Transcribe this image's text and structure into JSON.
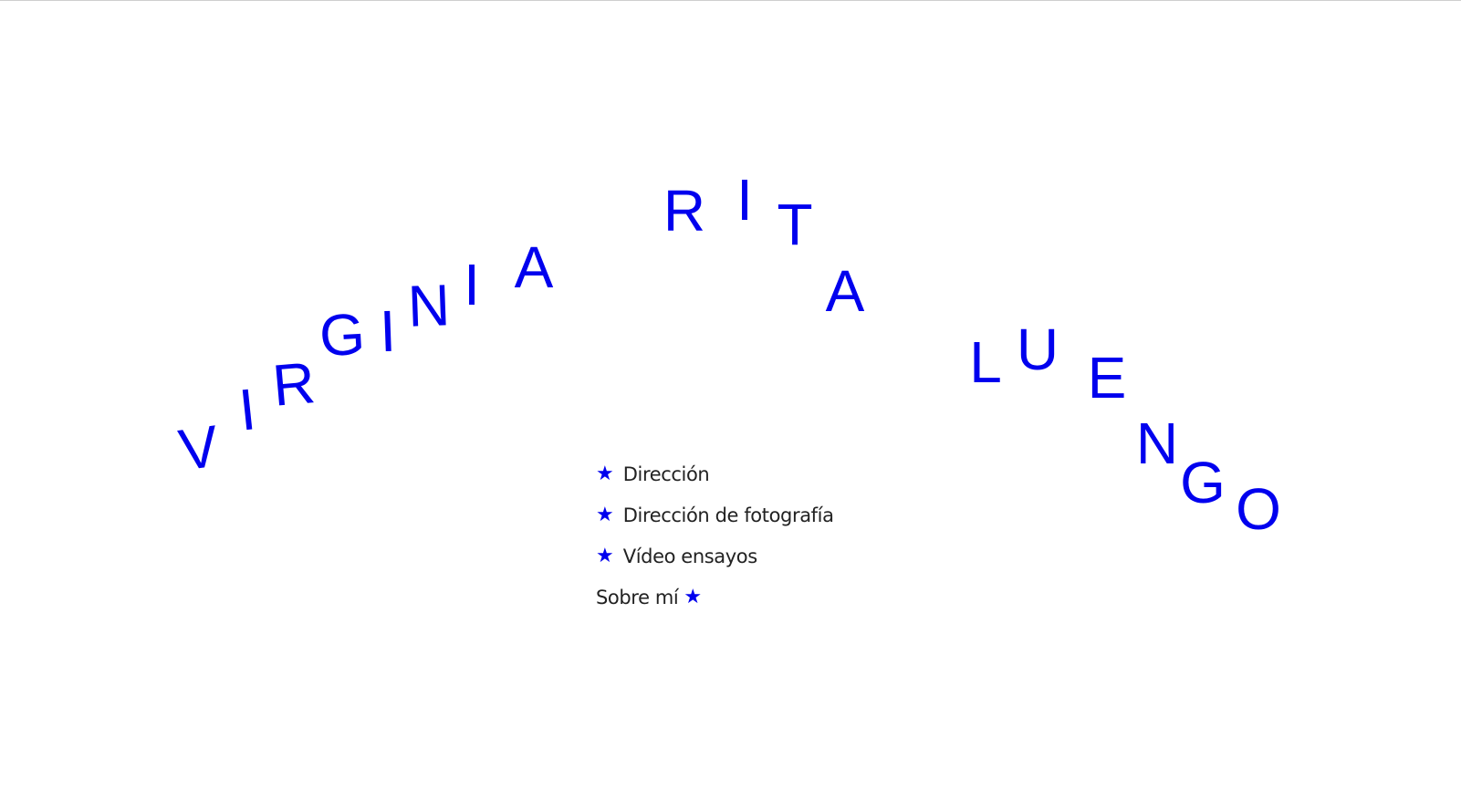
{
  "brand": {
    "accent_color": "#0000ee",
    "name_letters": [
      "V",
      "I",
      "R",
      "G",
      "I",
      "N",
      "I",
      "A",
      "R",
      "I",
      "T",
      "A",
      "L",
      "U",
      "E",
      "N",
      "G",
      "O"
    ]
  },
  "menu": {
    "items": [
      {
        "label": "Dirección",
        "icon": "star-icon",
        "star_position": "leading"
      },
      {
        "label": "Dirección de fotografía",
        "icon": "star-icon",
        "star_position": "leading"
      },
      {
        "label": "Vídeo ensayos",
        "icon": "star-icon",
        "star_position": "leading"
      },
      {
        "label": "Sobre mí",
        "icon": "star-icon",
        "star_position": "trailing"
      }
    ],
    "star_glyph": "★"
  }
}
